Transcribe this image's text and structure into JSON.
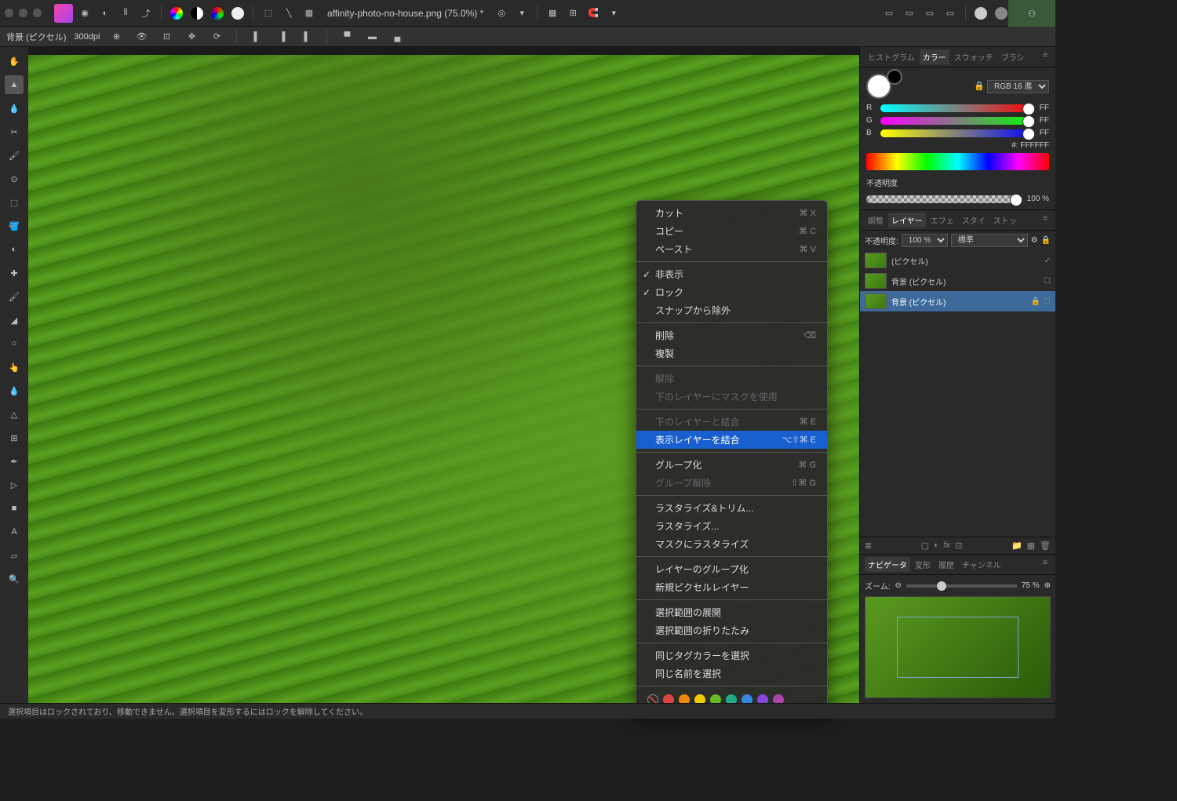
{
  "document": {
    "title": "affinity-photo-no-house.png (75.0%) *"
  },
  "context_bar": {
    "layer_label": "背景 (ピクセル)",
    "dpi": "300dpi"
  },
  "color_panel": {
    "tabs": [
      "ヒストグラム",
      "カラー",
      "スウォッチ",
      "ブラシ"
    ],
    "active_tab": 1,
    "mode": "RGB 16 進",
    "r_value": "FF",
    "g_value": "FF",
    "b_value": "FF",
    "hex_label": "#: FFFFFF",
    "opacity_label": "不透明度",
    "opacity_value": "100 %"
  },
  "layers_panel": {
    "tabs": [
      "調整",
      "レイヤー",
      "エフェ",
      "スタイ",
      "ストッ"
    ],
    "active_tab": 1,
    "opacity_label": "不透明度:",
    "opacity_value": "100 %",
    "blend_mode": "標準",
    "layers": [
      {
        "name": "(ピクセル)",
        "selected": false,
        "checked": true
      },
      {
        "name": "背景 (ピクセル)",
        "selected": false,
        "checked": false
      },
      {
        "name": "背景 (ピクセル)",
        "selected": true,
        "locked": true
      }
    ]
  },
  "nav_panel": {
    "tabs": [
      "ナビゲータ",
      "変形",
      "履歴",
      "チャンネル"
    ],
    "active_tab": 0,
    "zoom_label": "ズーム:",
    "zoom_value": "75 %"
  },
  "context_menu": {
    "items": [
      {
        "label": "カット",
        "shortcut": "⌘ X"
      },
      {
        "label": "コピー",
        "shortcut": "⌘ C"
      },
      {
        "label": "ペースト",
        "shortcut": "⌘ V"
      },
      {
        "sep": true
      },
      {
        "label": "非表示",
        "checked": true
      },
      {
        "label": "ロック",
        "checked": true
      },
      {
        "label": "スナップから除外"
      },
      {
        "sep": true
      },
      {
        "label": "削除",
        "shortcut": "⌫"
      },
      {
        "label": "複製"
      },
      {
        "sep": true
      },
      {
        "label": "解除",
        "disabled": true
      },
      {
        "label": "下のレイヤーにマスクを使用",
        "disabled": true
      },
      {
        "sep": true
      },
      {
        "label": "下のレイヤーと結合",
        "disabled": true,
        "shortcut": "⌘ E"
      },
      {
        "label": "表示レイヤーを結合",
        "highlight": true,
        "shortcut": "⌥⇧⌘ E"
      },
      {
        "sep": true
      },
      {
        "label": "グループ化",
        "shortcut": "⌘ G"
      },
      {
        "label": "グループ解除",
        "disabled": true,
        "shortcut": "⇧⌘ G"
      },
      {
        "sep": true
      },
      {
        "label": "ラスタライズ&トリム..."
      },
      {
        "label": "ラスタライズ..."
      },
      {
        "label": "マスクにラスタライズ"
      },
      {
        "sep": true
      },
      {
        "label": "レイヤーのグループ化"
      },
      {
        "label": "新規ピクセルレイヤー"
      },
      {
        "sep": true
      },
      {
        "label": "選択範囲の展開"
      },
      {
        "label": "選択範囲の折りたたみ"
      },
      {
        "sep": true
      },
      {
        "label": "同じタグカラーを選択"
      },
      {
        "label": "同じ名前を選択"
      }
    ],
    "tag_colors": [
      "#999",
      "#d44",
      "#e80",
      "#ec0",
      "#6b2",
      "#2a8",
      "#38d",
      "#84d",
      "#a4a"
    ]
  },
  "status_bar": {
    "text": "選択項目はロックされており、移動できません。選択項目を変形するにはロックを解除してください。"
  }
}
